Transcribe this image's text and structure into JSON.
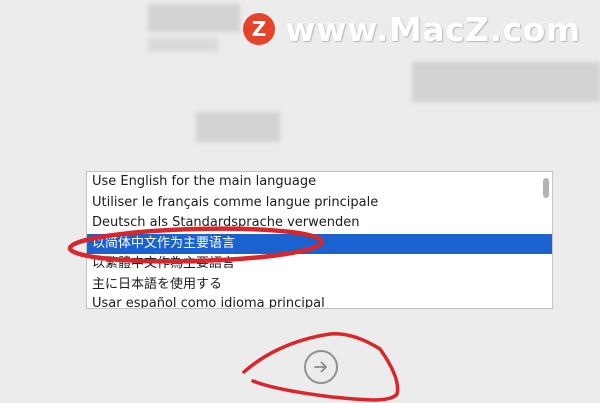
{
  "watermark": {
    "logo_letter": "Z",
    "text": "www.MacZ.com"
  },
  "language_list": {
    "items": [
      {
        "label": "Use English for the main language",
        "selected": false
      },
      {
        "label": "Utiliser le français comme langue principale",
        "selected": false
      },
      {
        "label": "Deutsch als Standardsprache verwenden",
        "selected": false
      },
      {
        "label": "以简体中文作为主要语言",
        "selected": true
      },
      {
        "label": "以繁體中文作為主要語言",
        "selected": false
      },
      {
        "label": "主に日本語を使用する",
        "selected": false
      },
      {
        "label": "Usar español como idioma principal",
        "selected": false
      }
    ]
  },
  "continue_button": {
    "icon": "arrow-right-circle-icon"
  },
  "colors": {
    "selection": "#1a62d0",
    "annotation_red": "#d8262a",
    "background": "#ececec"
  }
}
